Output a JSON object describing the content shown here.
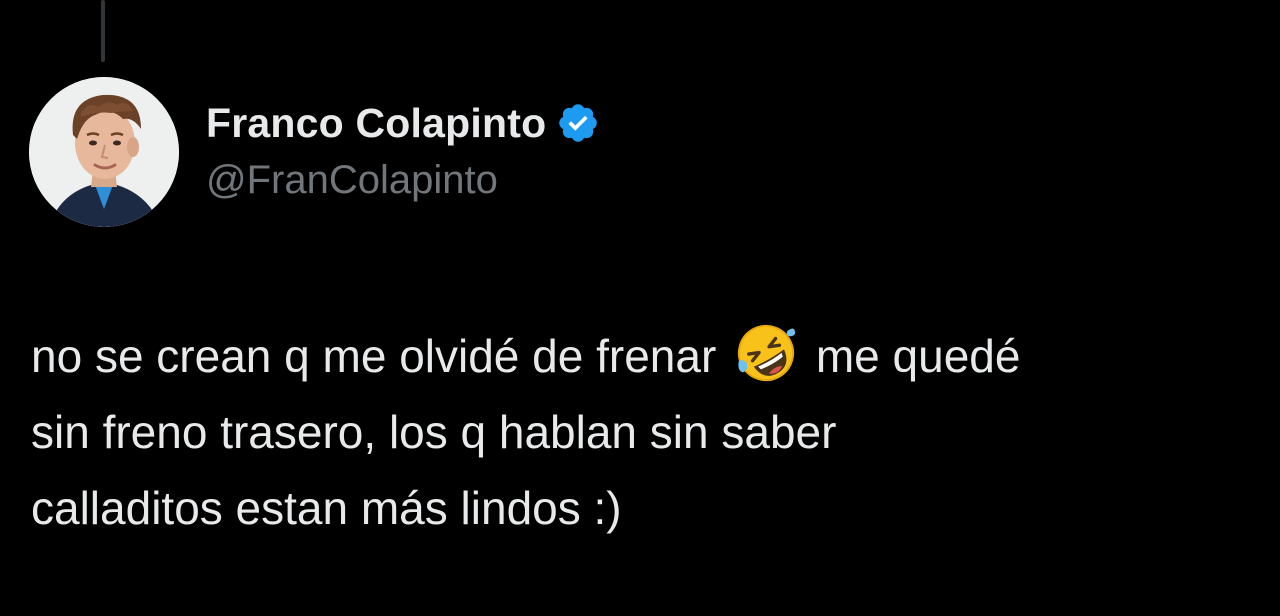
{
  "tweet": {
    "author": {
      "display_name": "Franco Colapinto",
      "handle": "@FranColapinto",
      "verified_icon": "verified-badge-icon",
      "avatar": "profile-photo"
    },
    "text_lines": [
      {
        "before_emoji": "no se crean q me olvidé de frenar",
        "emoji": "rolling-on-the-floor-laughing-emoji",
        "after_emoji": "me quedé"
      },
      {
        "text": "sin freno trasero, los q hablan sin saber"
      },
      {
        "text": "calladitos estan más lindos :)"
      }
    ]
  },
  "colors": {
    "background": "#000000",
    "text": "#e7e9ea",
    "secondary_text": "#71767b",
    "verified_blue": "#1d9bf0",
    "thread_line": "#333639"
  }
}
